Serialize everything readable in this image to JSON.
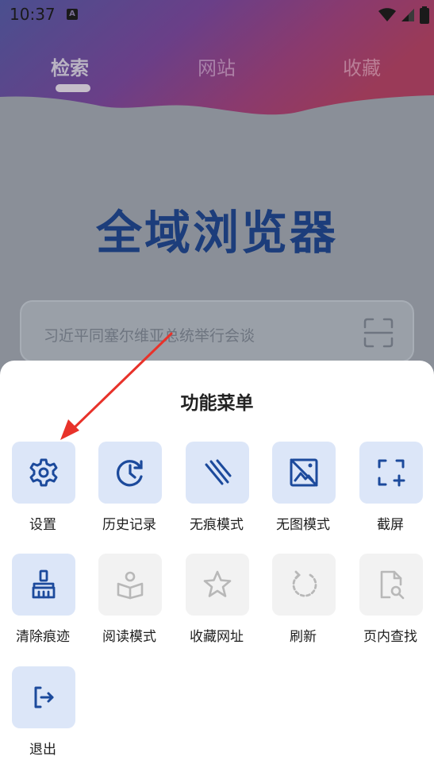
{
  "status_bar": {
    "time": "10:37",
    "notification_badge": "A",
    "icons": [
      "wifi-icon",
      "signal-icon",
      "battery-icon"
    ]
  },
  "tabs": [
    {
      "label": "检索",
      "active": true
    },
    {
      "label": "网站",
      "active": false
    },
    {
      "label": "收藏",
      "active": false
    }
  ],
  "app_title": "全域浏览器",
  "search": {
    "placeholder": "习近平同塞尔维亚总统举行会谈",
    "scan_icon": "scan-icon"
  },
  "menu": {
    "title": "功能菜单",
    "items": [
      {
        "label": "设置",
        "icon": "gear-icon",
        "enabled": true
      },
      {
        "label": "历史记录",
        "icon": "history-icon",
        "enabled": true
      },
      {
        "label": "无痕模式",
        "icon": "incognito-icon",
        "enabled": true
      },
      {
        "label": "无图模式",
        "icon": "no-image-icon",
        "enabled": true
      },
      {
        "label": "截屏",
        "icon": "screenshot-icon",
        "enabled": true
      },
      {
        "label": "清除痕迹",
        "icon": "broom-icon",
        "enabled": true
      },
      {
        "label": "阅读模式",
        "icon": "reading-icon",
        "enabled": false
      },
      {
        "label": "收藏网址",
        "icon": "star-icon",
        "enabled": false
      },
      {
        "label": "刷新",
        "icon": "refresh-icon",
        "enabled": false
      },
      {
        "label": "页内查找",
        "icon": "find-in-page-icon",
        "enabled": false
      },
      {
        "label": "退出",
        "icon": "exit-icon",
        "enabled": true
      }
    ]
  },
  "colors": {
    "accent": "#1c4a9c",
    "tile_active": "#dce6f8",
    "tile_disabled": "#f2f2f2",
    "icon_disabled": "#b8b8b8",
    "annotation_arrow": "#e8322a",
    "title_blue": "#1c3d7b"
  }
}
